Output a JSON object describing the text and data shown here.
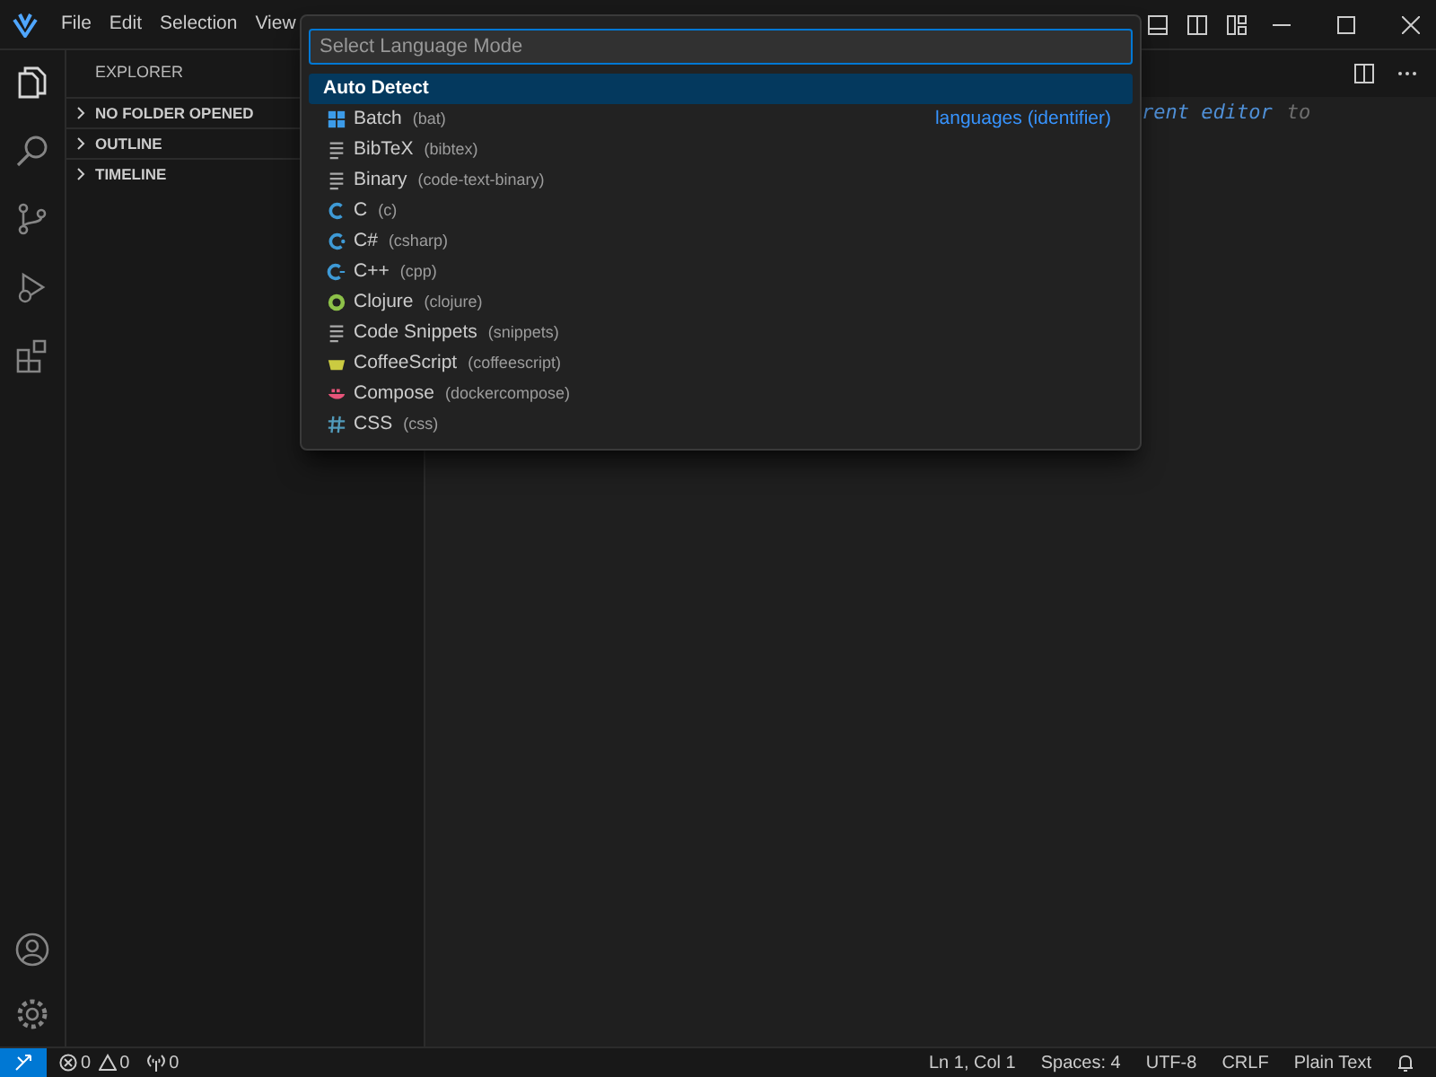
{
  "menu": [
    "File",
    "Edit",
    "Selection",
    "View"
  ],
  "sidebar": {
    "title": "EXPLORER",
    "sections": [
      {
        "label": "NO FOLDER OPENED",
        "expanded": false
      },
      {
        "label": "OUTLINE",
        "expanded": false
      },
      {
        "label": "TIMELINE",
        "expanded": false
      }
    ]
  },
  "editor": {
    "hint_parts": [
      {
        "text": "rent editor",
        "kind": "keyword"
      },
      {
        "text": "to",
        "kind": "plain"
      }
    ]
  },
  "quick_pick": {
    "placeholder": "Select Language Mode",
    "items": [
      {
        "label": "Auto Detect",
        "selected": true
      },
      {
        "label": "Batch",
        "id": "(bat)",
        "kind": "windows",
        "selected": false,
        "detail": "languages (identifier)"
      },
      {
        "label": "BibTeX",
        "id": "(bibtex)",
        "kind": "lines",
        "selected": false
      },
      {
        "label": "Binary",
        "id": "(code-text-binary)",
        "kind": "lines",
        "selected": false
      },
      {
        "label": "C",
        "id": "(c)",
        "kind": "c",
        "selected": false
      },
      {
        "label": "C#",
        "id": "(csharp)",
        "kind": "csharp",
        "selected": false
      },
      {
        "label": "C++",
        "id": "(cpp)",
        "kind": "cpp",
        "selected": false
      },
      {
        "label": "Clojure",
        "id": "(clojure)",
        "kind": "clojure",
        "selected": false
      },
      {
        "label": "Code Snippets",
        "id": "(snippets)",
        "kind": "lines",
        "selected": false
      },
      {
        "label": "CoffeeScript",
        "id": "(coffeescript)",
        "kind": "coffee",
        "selected": false
      },
      {
        "label": "Compose",
        "id": "(dockercompose)",
        "kind": "docker",
        "selected": false
      },
      {
        "label": "CSS",
        "id": "(css)",
        "kind": "hash",
        "selected": false
      }
    ]
  },
  "status_bar": {
    "errors": "0",
    "warnings": "0",
    "ports": "0",
    "items": [
      "Ln 1, Col 1",
      "Spaces: 4",
      "UTF-8",
      "CRLF",
      "Plain Text"
    ]
  }
}
